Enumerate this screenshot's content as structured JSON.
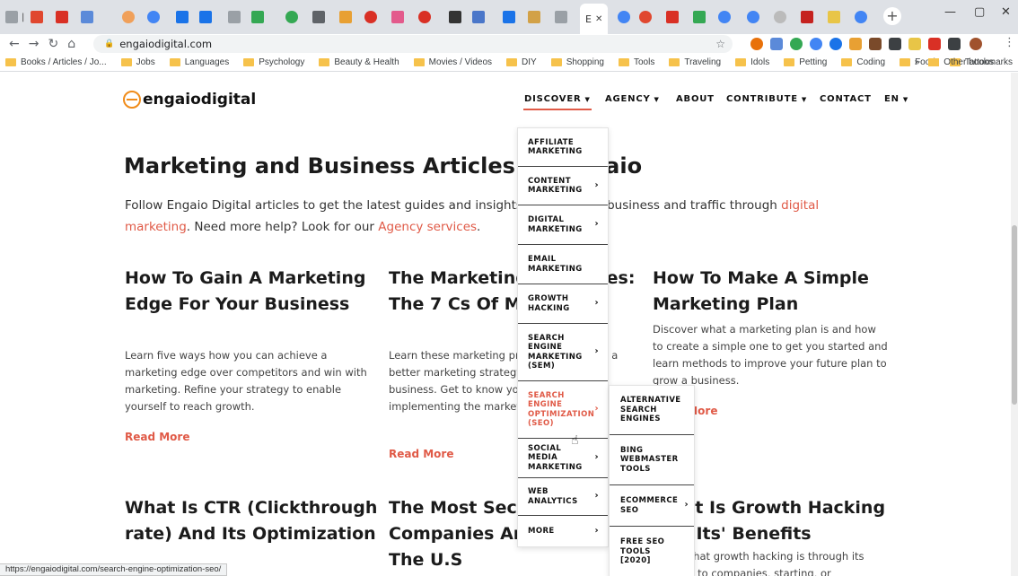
{
  "browser": {
    "active_tab_title": "E",
    "url": "engaiodigital.com",
    "bookmarks": [
      "Books / Articles / Jo...",
      "Jobs",
      "Languages",
      "Psychology",
      "Beauty & Health",
      "Movies / Videos",
      "DIY",
      "Shopping",
      "Tools",
      "Traveling",
      "Idols",
      "Petting",
      "Coding",
      "Food",
      "Tattoos"
    ],
    "overflow_label": "»",
    "other_bookmarks": "Other bookmarks",
    "status_url": "https://engaiodigital.com/search-engine-optimization-seo/"
  },
  "site": {
    "logo": "engaiodigital",
    "nav": {
      "discover": "DISCOVER",
      "agency": "AGENCY",
      "about": "ABOUT",
      "contribute": "CONTRIBUTE",
      "contact": "CONTACT",
      "lang": "EN"
    },
    "headline": "Marketing and Business Articles by Engaio",
    "intro": {
      "part1": "Follow Engaio Digital articles to get the latest guides and insights to grow your business and traffic through ",
      "link1": "digital marketing",
      "part2": ". Need more help? Look for our ",
      "link2": "Agency services",
      "part3": "."
    },
    "cards": [
      {
        "title": "How To Gain A Marketing Edge For Your Business",
        "body": "Learn five ways how you can achieve a marketing edge over competitors and win with marketing. Refine your strategy to enable yourself to reach growth.",
        "read_more": "Read More"
      },
      {
        "title": "The Marketing Principles: The 7 Cs Of Marketing",
        "body": "Learn these marketing principles to create a better marketing strategy and grow your business. Get to know your business, implementing the marketing basics.",
        "read_more": "Read More"
      },
      {
        "title": "How To Make A Simple Marketing Plan",
        "body": "Discover what a marketing plan is and how to create a simple one to get you started and learn methods to improve your future plan to grow a business.",
        "read_more": "Read More"
      },
      {
        "title": "What Is CTR (Clickthrough rate) And Its Optimization"
      },
      {
        "title": "The Most Secure S&P500 Companies And Brands In The U.S"
      },
      {
        "title": "What Is Growth Hacking And Its' Benefits",
        "body": "Learn what growth hacking is through its benefits to companies, starting, or"
      }
    ],
    "dropdown": [
      {
        "label": "AFFILIATE MARKETING",
        "arrow": ""
      },
      {
        "label": "CONTENT MARKETING",
        "arrow": "›"
      },
      {
        "label": "DIGITAL MARKETING",
        "arrow": "›"
      },
      {
        "label": "EMAIL MARKETING",
        "arrow": ""
      },
      {
        "label": "GROWTH HACKING",
        "arrow": "›"
      },
      {
        "label": "SEARCH ENGINE MARKETING (SEM)",
        "arrow": "›"
      },
      {
        "label": "SEARCH ENGINE OPTIMIZATION (SEO)",
        "arrow": "›"
      },
      {
        "label": "SOCIAL MEDIA MARKETING",
        "arrow": "›"
      },
      {
        "label": "WEB ANALYTICS",
        "arrow": "›"
      },
      {
        "label": "MORE",
        "arrow": "›"
      }
    ],
    "submenu": [
      {
        "label": "ALTERNATIVE SEARCH ENGINES",
        "arrow": ""
      },
      {
        "label": "BING WEBMASTER TOOLS",
        "arrow": ""
      },
      {
        "label": "ECOMMERCE SEO",
        "arrow": "›"
      },
      {
        "label": "FREE SEO TOOLS [2020]",
        "arrow": ""
      }
    ]
  }
}
